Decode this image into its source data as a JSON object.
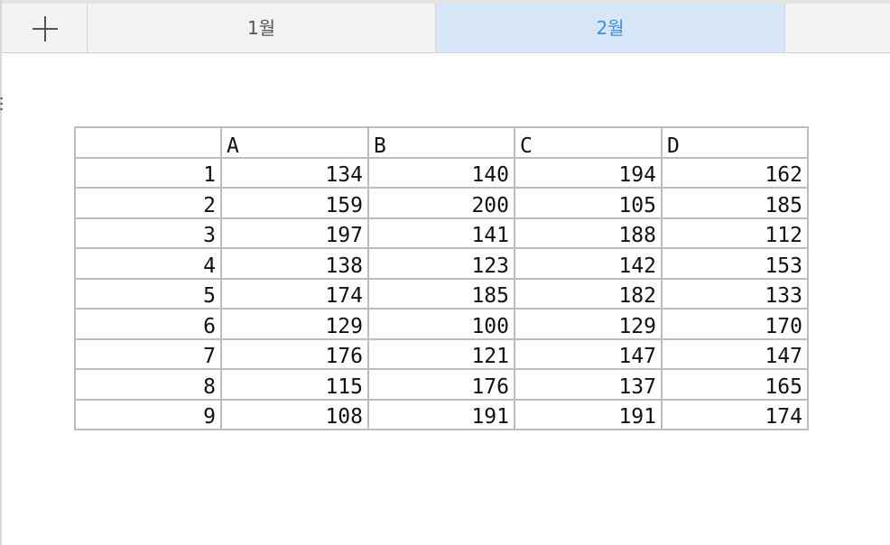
{
  "tabs": {
    "add_label": "+",
    "items": [
      {
        "label": "1월",
        "active": false
      },
      {
        "label": "2월",
        "active": true
      }
    ],
    "active_color": "#3d8ee3",
    "active_bg": "#d7e7f8"
  },
  "table": {
    "corner": "",
    "columns": [
      "A",
      "B",
      "C",
      "D"
    ],
    "rows": [
      {
        "label": "1",
        "cells": [
          "134",
          "140",
          "194",
          "162"
        ]
      },
      {
        "label": "2",
        "cells": [
          "159",
          "200",
          "105",
          "185"
        ]
      },
      {
        "label": "3",
        "cells": [
          "197",
          "141",
          "188",
          "112"
        ]
      },
      {
        "label": "4",
        "cells": [
          "138",
          "123",
          "142",
          "153"
        ]
      },
      {
        "label": "5",
        "cells": [
          "174",
          "185",
          "182",
          "133"
        ]
      },
      {
        "label": "6",
        "cells": [
          "129",
          "100",
          "129",
          "170"
        ]
      },
      {
        "label": "7",
        "cells": [
          "176",
          "121",
          "147",
          "147"
        ]
      },
      {
        "label": "8",
        "cells": [
          "115",
          "176",
          "137",
          "165"
        ]
      },
      {
        "label": "9",
        "cells": [
          "108",
          "191",
          "191",
          "174"
        ]
      }
    ]
  }
}
